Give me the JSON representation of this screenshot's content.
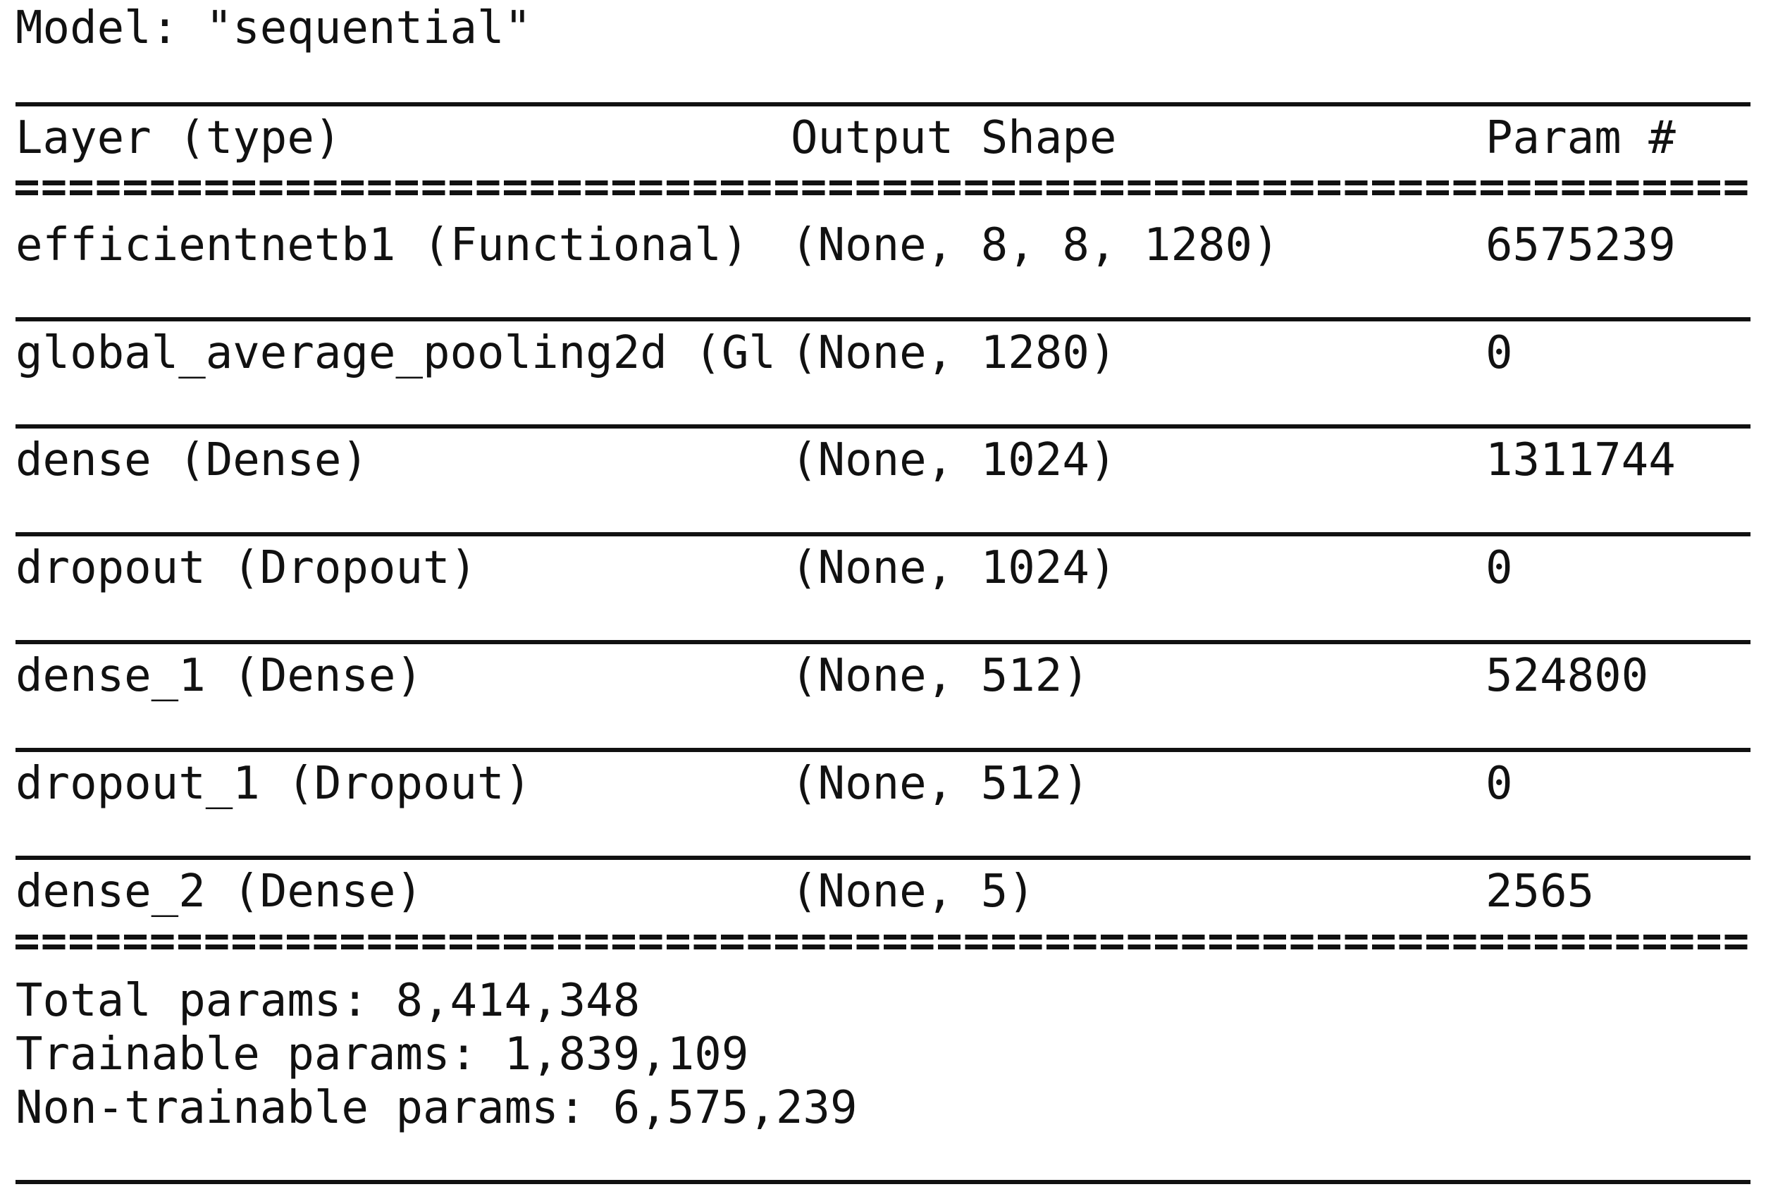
{
  "model_title": "Model: \"sequential\"",
  "header": {
    "layer": "Layer (type)",
    "output_shape": "Output Shape",
    "params": "Param #"
  },
  "rows": [
    {
      "layer": "efficientnetb1 (Functional)",
      "output_shape": "(None, 8, 8, 1280)",
      "params": "6575239"
    },
    {
      "layer": "global_average_pooling2d (Gl",
      "output_shape": "(None, 1280)",
      "params": "0"
    },
    {
      "layer": "dense (Dense)",
      "output_shape": "(None, 1024)",
      "params": "1311744"
    },
    {
      "layer": "dropout (Dropout)",
      "output_shape": "(None, 1024)",
      "params": "0"
    },
    {
      "layer": "dense_1 (Dense)",
      "output_shape": "(None, 512)",
      "params": "524800"
    },
    {
      "layer": "dropout_1 (Dropout)",
      "output_shape": "(None, 512)",
      "params": "0"
    },
    {
      "layer": "dense_2 (Dense)",
      "output_shape": "(None, 5)",
      "params": "2565"
    }
  ],
  "summary": {
    "total": "Total params: 8,414,348",
    "trainable": "Trainable params: 1,839,109",
    "non_trainable": "Non-trainable params: 6,575,239"
  }
}
